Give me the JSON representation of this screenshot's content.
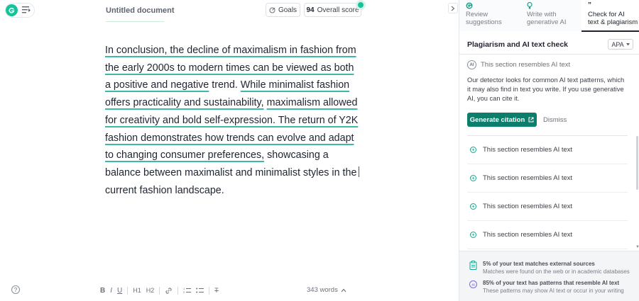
{
  "editor": {
    "document_title": "Untitled document",
    "goals_label": "Goals",
    "overall_score_value": "94",
    "overall_score_label": "Overall score",
    "body_lines": [
      {
        "text": "In conclusion, the decline of maximalism in fashion from",
        "underlined": true
      },
      {
        "text": "the early 2000s to modern times can be viewed as both",
        "underlined": true
      },
      {
        "text_parts": [
          "a positive and negative",
          " trend. ",
          "While minimalist fashion"
        ]
      },
      {
        "text_parts": [
          "offers practicality and sustainability,",
          " ",
          "maximalism allowed"
        ]
      },
      {
        "text": "for creativity and bold self-expression. The return of Y2K",
        "underlined": true
      },
      {
        "text": "fashion demonstrates how trends can evolve and adapt",
        "underlined": true
      },
      {
        "text_parts": [
          "to changing consumer preferences,",
          " showcasing a"
        ]
      },
      {
        "text": "balance between maximalist and minimalist styles in the",
        "underlined": false
      },
      {
        "text": "current fashion landscape.",
        "underlined": false
      }
    ],
    "word_count": "343 words",
    "toolbar": {
      "bold": "B",
      "italic": "I",
      "underline": "U",
      "h1": "H1",
      "h2": "H2",
      "clear_format": "T"
    }
  },
  "sidebar": {
    "tabs": [
      {
        "label_line1": "Review",
        "label_line2": "suggestions",
        "icon": "grammarly-g-icon"
      },
      {
        "label_line1": "Write with",
        "label_line2": "generative AI",
        "icon": "lightbulb-icon"
      },
      {
        "label_line1": "Check for AI",
        "label_line2": "text & plagiarism",
        "icon": "quote-icon",
        "active": true
      }
    ],
    "panel_title": "Plagiarism and AI text check",
    "citation_style": "APA",
    "card": {
      "badge": "AI",
      "heading": "This section resembles AI text",
      "description": "Our detector looks for common AI text patterns, which it may also find in text you write. If you use generative AI, you can cite it.",
      "primary_button": "Generate citation",
      "secondary_button": "Dismiss"
    },
    "items": [
      "This section resembles AI text",
      "This section resembles AI text",
      "This section resembles AI text",
      "This section resembles AI text"
    ],
    "footer": [
      {
        "title": "5% of your text matches external sources",
        "subtitle": "Matches were found on the web or in academic databases",
        "icon": "clipboard-icon"
      },
      {
        "title": "85% of your text has patterns that resemble AI text",
        "subtitle": "These patterns may show AI text or occur in your writing",
        "icon": "ai-detect-icon"
      }
    ]
  },
  "colors": {
    "brand_green": "#15c39a",
    "primary_button": "#0d7d6c",
    "underline": "#3fb8a7"
  }
}
